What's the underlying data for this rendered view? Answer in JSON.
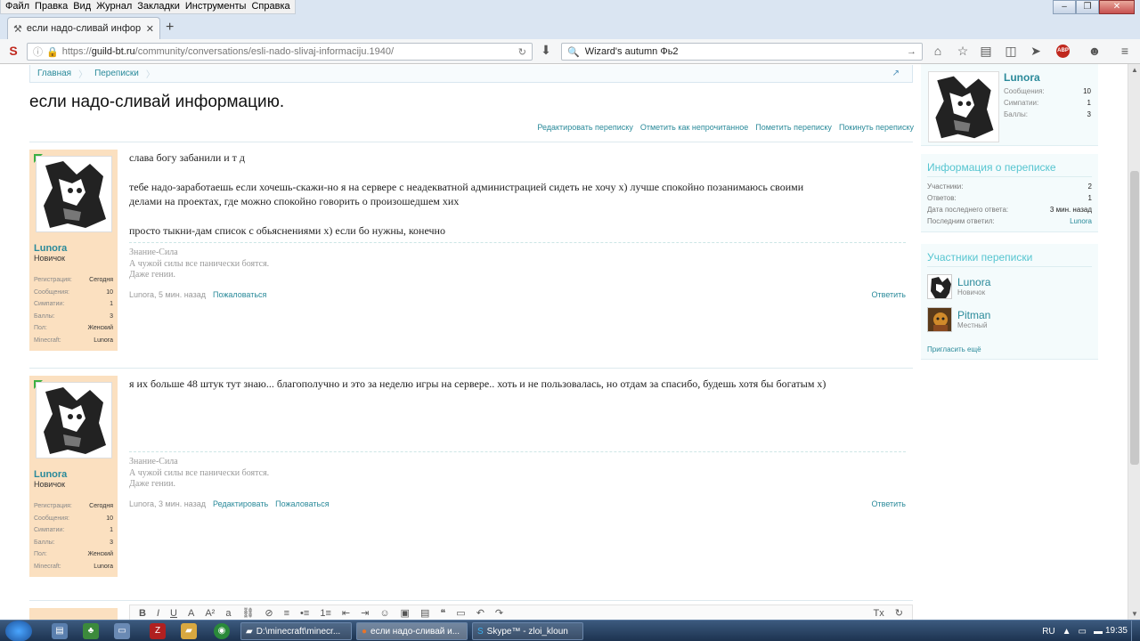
{
  "menubar": {
    "items": [
      "Файл",
      "Правка",
      "Вид",
      "Журнал",
      "Закладки",
      "Инструменты",
      "Справка"
    ]
  },
  "tab": {
    "title": "если надо-сливай инфор..."
  },
  "address": {
    "scheme": "https://",
    "host": "guild-bt.ru",
    "path": "/community/conversations/esli-nado-slivaj-informaciju.1940/"
  },
  "search": {
    "value": "Wizard's autumn  Фь2"
  },
  "colors": {
    "accent": "#2a8a9a",
    "userpanel": "#fbe0c0",
    "sidebar_heading": "#56c5d0"
  },
  "breadcrumb": [
    "Главная",
    "Переписки"
  ],
  "page_title": "если надо-сливай информацию.",
  "actions": [
    "Редактировать переписку",
    "Отметить как непрочитанное",
    "Пометить переписку",
    "Покинуть переписку"
  ],
  "stat_labels": [
    "Регистрация:",
    "Сообщения:",
    "Симпатии:",
    "Баллы:",
    "Пол:",
    "Minecraft:"
  ],
  "messages": [
    {
      "user": "Lunora",
      "rank": "Новичок",
      "stats": [
        "Сегодня",
        "10",
        "1",
        "3",
        "Женский",
        "Lunora"
      ],
      "paragraphs": [
        "слава богу забанили и т д",
        "тебе надо-заработаешь если хочешь-скажи-но я на сервере с неадекватной администрацией сидеть не хочу x) лучше спокойно позанимаюсь своими",
        "делами на проектах, где можно спокойно говорить о произошедшем xих",
        "просто тыкни-дам список с обьяснениями x) если бо нужны, конечно"
      ],
      "signature": [
        "Знание-Сила",
        "А чужой силы все панически боятся.",
        "Даже гении."
      ],
      "meta": "Lunora, 5 мин. назад",
      "links": [
        "Пожаловаться"
      ],
      "reply": "Ответить"
    },
    {
      "user": "Lunora",
      "rank": "Новичок",
      "stats": [
        "Сегодня",
        "10",
        "1",
        "3",
        "Женский",
        "Lunora"
      ],
      "paragraphs": [
        "я их больше 48 штук тут знаю... благополучно и это за неделю игры на сервере.. хоть и не пользовалась, но отдам за спасибо, будешь хотя бы богатым x)"
      ],
      "signature": [
        "Знание-Сила",
        "А чужой силы все панически боятся.",
        "Даже гении."
      ],
      "meta": "Lunora, 3 мин. назад",
      "links": [
        "Редактировать",
        "Пожаловаться"
      ],
      "reply": "Ответить"
    }
  ],
  "sidebar": {
    "user": {
      "name": "Lunora",
      "stats": [
        {
          "k": "Сообщения:",
          "v": "10"
        },
        {
          "k": "Симпатии:",
          "v": "1"
        },
        {
          "k": "Баллы:",
          "v": "3"
        }
      ]
    },
    "info": {
      "heading": "Информация о переписке",
      "rows": [
        {
          "k": "Участники:",
          "v": "2"
        },
        {
          "k": "Ответов:",
          "v": "1"
        },
        {
          "k": "Дата последнего ответа:",
          "v": "3 мин. назад"
        },
        {
          "k": "Последним ответил:",
          "v": "Lunora"
        }
      ]
    },
    "participants": {
      "heading": "Участники переписки",
      "list": [
        {
          "name": "Lunora",
          "rank": "Новичок"
        },
        {
          "name": "Pitman",
          "rank": "Местный"
        }
      ],
      "invite": "Пригласить ещё"
    }
  },
  "editor": {
    "tools": [
      "B",
      "I",
      "U",
      "A",
      "A²",
      "a",
      "⛓",
      "⊘",
      "≡",
      "•≡",
      "1≡",
      "⇤",
      "⇥",
      "☺",
      "▣",
      "▤",
      "❝",
      "▭",
      "↶",
      "↷",
      "Tx",
      "↻"
    ]
  },
  "taskbar": {
    "tasks": [
      "D:\\minecraft\\minecr...",
      "если надо-сливай и...",
      "Skype™ - zloi_kloun"
    ],
    "lang": "RU",
    "clock": "19:35"
  }
}
